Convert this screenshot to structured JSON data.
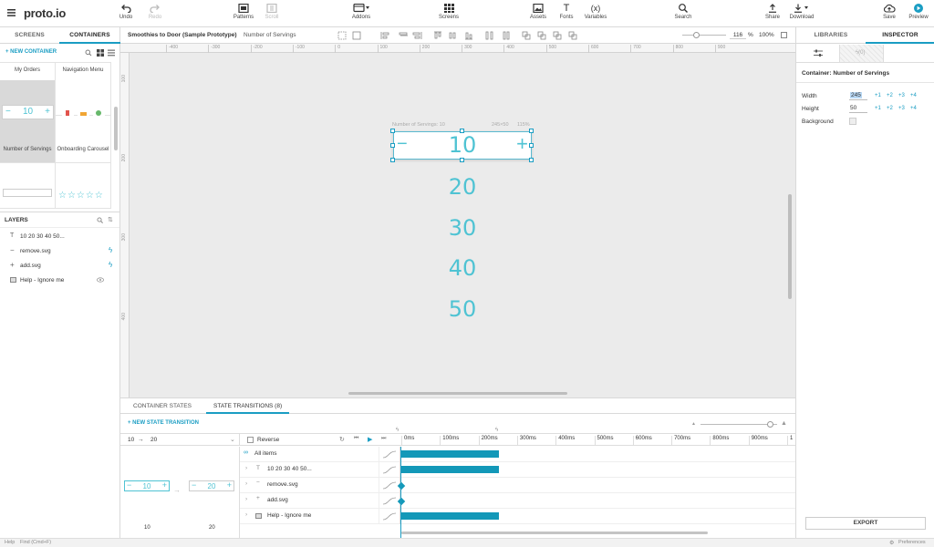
{
  "app": {
    "logo": "proto.io"
  },
  "toolbar": {
    "undo": "Undo",
    "redo": "Redo",
    "patterns": "Patterns",
    "scroll": "Scroll",
    "addons": "Addons",
    "screens": "Screens",
    "assets": "Assets",
    "fonts": "Fonts",
    "variables": "Variables",
    "search": "Search",
    "share": "Share",
    "download": "Download",
    "save": "Save",
    "preview": "Preview"
  },
  "left_panel": {
    "tabs": [
      "SCREENS",
      "CONTAINERS"
    ],
    "new_container": "NEW CONTAINER",
    "thumbs": [
      {
        "label": "My Orders"
      },
      {
        "label": "Navigation Menu"
      },
      {
        "label": "Number of Servings",
        "value": "10"
      },
      {
        "label": "Onboarding Carousel"
      }
    ],
    "layers_title": "LAYERS",
    "layers": [
      {
        "label": "10 20 30 40 50..."
      },
      {
        "label": "remove.svg"
      },
      {
        "label": "add.svg"
      },
      {
        "label": "Help - Ignore me"
      }
    ]
  },
  "canvas_bar": {
    "project": "Smoothies to Door (Sample Prototype)",
    "container": "Number of Servings",
    "zoom_value": "116",
    "zoom_unit": "%",
    "zoom_fit": "100%"
  },
  "ruler": {
    "h": [
      "-400",
      "-300",
      "-200",
      "-100",
      "0",
      "100",
      "200",
      "300",
      "400",
      "500",
      "600",
      "700",
      "800",
      "900"
    ],
    "v": [
      "100",
      "200",
      "300",
      "400"
    ]
  },
  "canvas": {
    "selection_label": "Number of Servings: 10",
    "size_label": "245×50",
    "scale_label": "115%",
    "stepper_value": "10",
    "states": [
      "20",
      "30",
      "40",
      "50"
    ]
  },
  "bottom": {
    "tabs": [
      "CONTAINER STATES",
      "STATE TRANSITIONS (8)"
    ],
    "new_transition": "NEW STATE TRANSITION",
    "from_state": "10",
    "to_state": "20",
    "reverse": "Reverse",
    "ticks": [
      "0ms",
      "100ms",
      "200ms",
      "300ms",
      "400ms",
      "500ms",
      "600ms",
      "700ms",
      "800ms",
      "900ms",
      "1"
    ],
    "rows": [
      {
        "label": "All items"
      },
      {
        "label": "10 20 30 40 50..."
      },
      {
        "label": "remove.svg"
      },
      {
        "label": "add.svg"
      },
      {
        "label": "Help - Ignore me"
      }
    ],
    "preview_from": "10",
    "preview_to": "20"
  },
  "right_panel": {
    "tabs": [
      "LIBRARIES",
      "INSPECTOR"
    ],
    "container_prefix": "Container:",
    "container_name": "Number of Servings",
    "width_label": "Width",
    "width_value": "245",
    "height_label": "Height",
    "height_value": "50",
    "background_label": "Background",
    "increments": [
      "+1",
      "+2",
      "+3",
      "+4"
    ],
    "export": "EXPORT"
  },
  "statusbar": {
    "help": "Help",
    "find": "Find (Cmd+F)",
    "preferences": "Preferences"
  },
  "colors": {
    "accent": "#1a9dc3",
    "state_text": "#4fc3d3",
    "bar": "#1398b8"
  }
}
